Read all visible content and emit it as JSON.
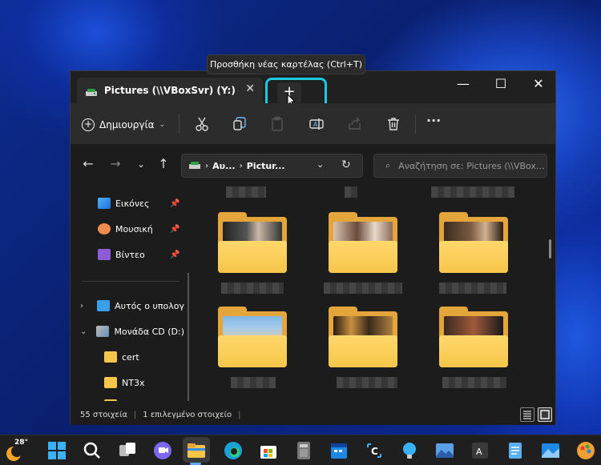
{
  "tooltip": "Προσθήκη νέας καρτέλας (Ctrl+T)",
  "tab": {
    "title": "Pictures (\\\\VBoxSvr) (Y:)",
    "close": "✕"
  },
  "newtab": {
    "label": "+"
  },
  "window_controls": {
    "minimize": "—",
    "maximize": "☐",
    "close": "✕"
  },
  "toolbar": {
    "create_label": "Δημιουργία",
    "more": "···"
  },
  "address": {
    "crumb1": "Αυ...",
    "crumb2": "Pictur...",
    "search_placeholder": "Αναζήτηση σε: Pictures (\\\\VBox..."
  },
  "sidebar": {
    "items": [
      {
        "label": "Εικόνες",
        "icon": "pictures-icon",
        "pinned": true
      },
      {
        "label": "Μουσική",
        "icon": "music-icon",
        "pinned": true
      },
      {
        "label": "Βίντεο",
        "icon": "video-icon",
        "pinned": true
      },
      {
        "label": "Αυτός ο υπολογ",
        "icon": "this-pc-icon"
      },
      {
        "label": "Μονάδα CD (D:)",
        "icon": "cd-drive-icon"
      },
      {
        "label": "cert",
        "icon": "folder-icon"
      },
      {
        "label": "NT3x",
        "icon": "folder-icon"
      }
    ]
  },
  "status": {
    "items_count": "55 στοιχεία",
    "selected": "1 επιλεγμένο στοιχείο"
  },
  "taskbar": {
    "temperature": "28°"
  },
  "colors": {
    "accent": "#1ec8e0",
    "folder": "#f6c64a",
    "window_bg": "#1c1c1c"
  }
}
